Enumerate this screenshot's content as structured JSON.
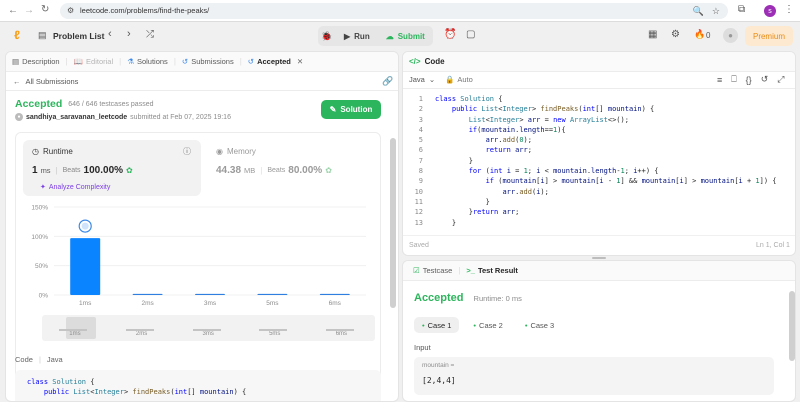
{
  "browser": {
    "url": "leetcode.com/problems/find-the-peaks/",
    "profile_letter": "s"
  },
  "appbar": {
    "problem_list": "Problem List",
    "run": "Run",
    "submit": "Submit",
    "fire_count": "0",
    "premium": "Premium"
  },
  "left_tabs": {
    "description": "Description",
    "editorial": "Editorial",
    "solutions": "Solutions",
    "submissions": "Submissions",
    "accepted": "Accepted"
  },
  "submission": {
    "back_label": "All Submissions",
    "status": "Accepted",
    "testcases": "646 / 646 testcases passed",
    "user": "sandhiya_saravanan_leetcode",
    "submitted_at": "submitted at Feb 07, 2025 19:16",
    "solution_button": "Solution",
    "runtime_title": "Runtime",
    "runtime_value": "1",
    "runtime_unit": "ms",
    "runtime_beats_label": "Beats",
    "runtime_beats_value": "100.00%",
    "analyze": "Analyze Complexity",
    "memory_title": "Memory",
    "memory_value": "44.38",
    "memory_unit": "MB",
    "memory_beats_label": "Beats",
    "memory_beats_value": "80.00%"
  },
  "chart_data": {
    "type": "bar",
    "categories": [
      "1ms",
      "2ms",
      "3ms",
      "5ms",
      "6ms"
    ],
    "values": [
      97,
      2,
      2,
      2,
      2
    ],
    "ylim": [
      0,
      150
    ],
    "yticks": [
      "150%",
      "100%",
      "50%",
      "0%"
    ],
    "ytick_values": [
      150,
      100,
      50,
      0
    ],
    "highlight_category": "1ms",
    "brush_labels": [
      "1ms",
      "2ms",
      "3ms",
      "5ms",
      "6ms"
    ]
  },
  "left_code": {
    "header_code": "Code",
    "header_lang": "Java",
    "lines": [
      "class Solution {",
      "    public List<Integer> findPeaks(int[] mountain) {"
    ]
  },
  "editor": {
    "title": "Code",
    "language": "Java",
    "auto": "Auto",
    "saved": "Saved",
    "cursor": "Ln 1, Col 1",
    "line_numbers": [
      "1",
      "2",
      "3",
      "4",
      "5",
      "6",
      "7",
      "8",
      "9",
      "10",
      "11",
      "12",
      "13"
    ],
    "lines": [
      "class Solution {",
      "    public List<Integer> findPeaks(int[] mountain) {",
      "        List<Integer> arr = new ArrayList<>();",
      "        if(mountain.length==1){",
      "            arr.add(0);",
      "            return arr;",
      "        }",
      "        for (int i = 1; i < mountain.length-1; i++) {",
      "            if (mountain[i] > mountain[i - 1] && mountain[i] > mountain[i + 1]) {",
      "                arr.add(i);",
      "            }",
      "        }return arr;",
      "    }"
    ]
  },
  "test": {
    "testcase_tab": "Testcase",
    "result_tab": "Test Result",
    "status": "Accepted",
    "runtime": "Runtime: 0 ms",
    "cases": [
      "Case 1",
      "Case 2",
      "Case 3"
    ],
    "input_label": "Input",
    "param_name": "mountain =",
    "param_value": "[2,4,4]"
  }
}
